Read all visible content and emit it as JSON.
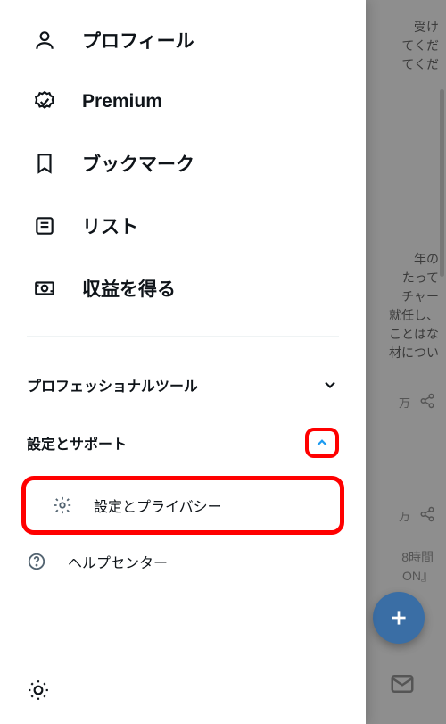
{
  "nav": {
    "profile": {
      "label": "プロフィール"
    },
    "premium": {
      "label": "Premium"
    },
    "bookmarks": {
      "label": "ブックマーク"
    },
    "lists": {
      "label": "リスト"
    },
    "monetization": {
      "label": "収益を得る"
    }
  },
  "sections": {
    "pro_tools": {
      "label": "プロフェッショナルツール"
    },
    "settings_support": {
      "label": "設定とサポート"
    }
  },
  "subitems": {
    "settings_privacy": {
      "label": "設定とプライバシー"
    },
    "help_center": {
      "label": "ヘルプセンター"
    }
  },
  "background": {
    "snippet1": "受け\nてくだ\nてくだ",
    "snippet2": "年の\nたって\nチャー\n就任し、\nことはな\n材につい",
    "time_label": "8時間",
    "on_label": "ON』",
    "count_label": "万"
  }
}
